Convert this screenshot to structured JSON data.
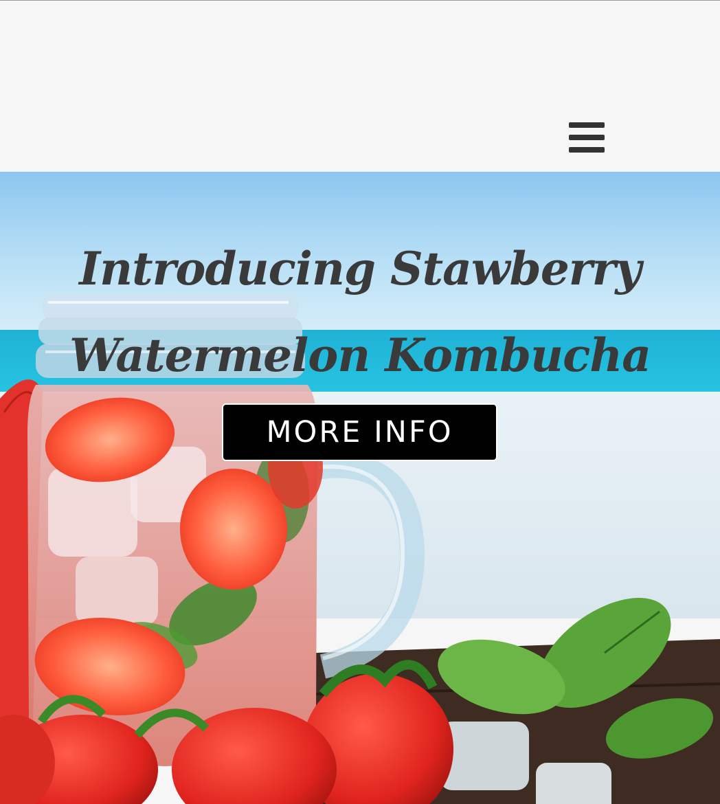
{
  "header": {
    "menu_icon": "hamburger-menu-icon"
  },
  "hero": {
    "title": "Introducing Stawberry Watermelon Kombucha",
    "button_label": "MORE INFO"
  },
  "colors": {
    "header_bg": "#f6f6f6",
    "title_text": "#3a3a3a",
    "button_bg": "#000000",
    "button_text": "#ffffff",
    "menu_icon": "#333333"
  }
}
